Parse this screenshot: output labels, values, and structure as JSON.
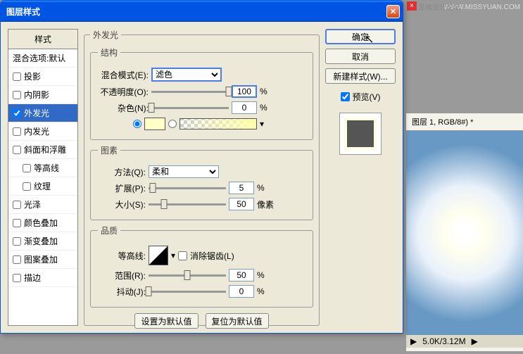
{
  "watermark": "WWW.MISSYUAN.COM",
  "logoTag": "×",
  "logoText": "思缘设计论坛",
  "bgWindow": {
    "tab": "图层 1, RGB/8#) *",
    "zoom": "5.0K/3.12M"
  },
  "dialog": {
    "title": "图层样式",
    "stylesHeader": "样式",
    "blendOptionsLabel": "混合选项:默认",
    "styles": {
      "dropShadow": "投影",
      "innerShadow": "内阴影",
      "outerGlow": "外发光",
      "innerGlow": "内发光",
      "bevelEmboss": "斜面和浮雕",
      "contour": "等高线",
      "texture": "纹理",
      "satin": "光泽",
      "colorOverlay": "颜色叠加",
      "gradientOverlay": "渐变叠加",
      "patternOverlay": "图案叠加",
      "stroke": "描边"
    },
    "panel": {
      "title": "外发光",
      "structure": "结构",
      "blendMode": "混合模式(E):",
      "blendModeValue": "滤色",
      "opacity": "不透明度(O):",
      "opacityValue": "100",
      "noise": "杂色(N):",
      "noiseValue": "0",
      "percent": "%",
      "elements": "图素",
      "technique": "方法(Q):",
      "techniqueValue": "柔和",
      "spread": "扩展(P):",
      "spreadValue": "5",
      "size": "大小(S):",
      "sizeValue": "50",
      "px": "像素",
      "quality": "品质",
      "contourLabel": "等高线:",
      "antiAlias": "消除锯齿(L)",
      "range": "范围(R):",
      "rangeValue": "50",
      "jitter": "抖动(J):",
      "jitterValue": "0",
      "makeDefault": "设置为默认值",
      "resetDefault": "复位为默认值"
    },
    "buttons": {
      "ok": "确定",
      "cancel": "取消",
      "newStyle": "新建样式(W)...",
      "preview": "预览(V)"
    }
  }
}
